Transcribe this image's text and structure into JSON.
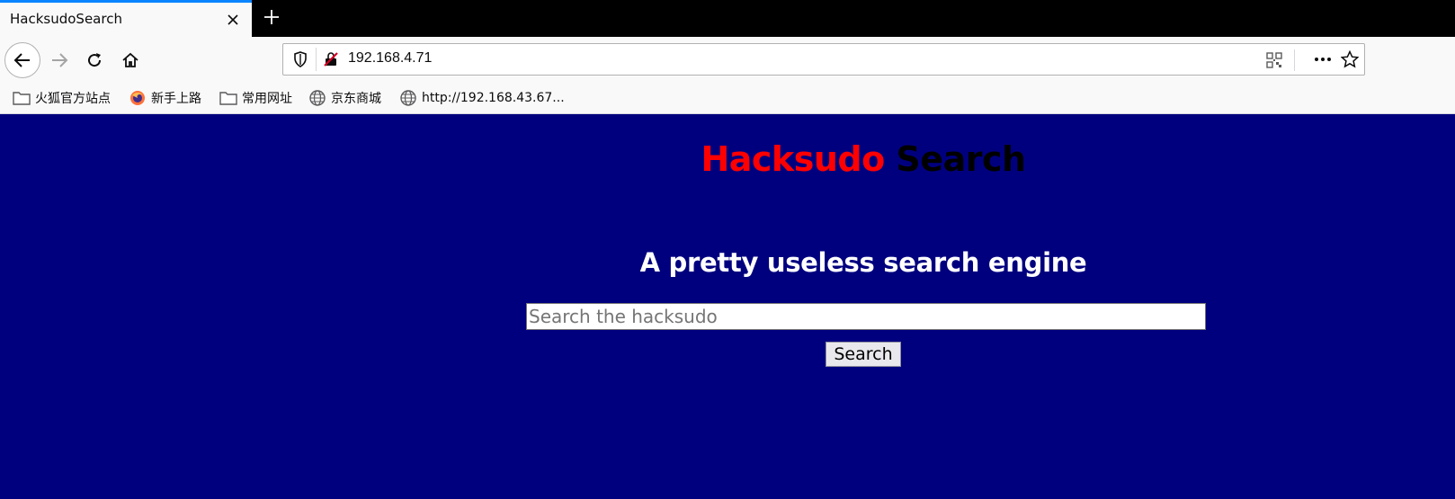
{
  "browser": {
    "tab": {
      "title": "HacksudoSearch",
      "close_icon": "close-icon"
    },
    "new_tab_icon": "plus-icon",
    "address": {
      "url": "192.168.4.71"
    },
    "bookmarks": [
      {
        "label": "火狐官方站点",
        "icon": "folder-icon"
      },
      {
        "label": "新手上路",
        "icon": "firefox-icon"
      },
      {
        "label": "常用网址",
        "icon": "folder-icon"
      },
      {
        "label": "京东商城",
        "icon": "globe-icon"
      },
      {
        "label": "http://192.168.43.67...",
        "icon": "globe-icon"
      }
    ]
  },
  "page": {
    "title_part1": "Hacksudo",
    "title_part2": "Search",
    "subtitle": "A pretty useless search engine",
    "search_placeholder": "Search the hacksudo",
    "search_button": "Search",
    "colors": {
      "background": "#00007f",
      "title_red": "#ff0000",
      "title_dark": "#000000"
    }
  }
}
